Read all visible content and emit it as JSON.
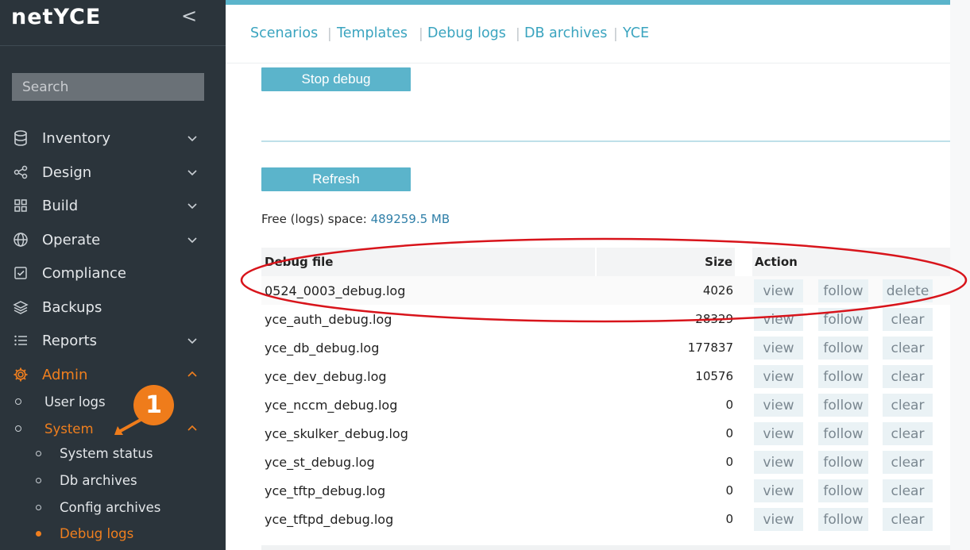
{
  "app": {
    "logo": "netYCE",
    "collapse_icon": "chevron-left-icon"
  },
  "search": {
    "placeholder": "Search"
  },
  "nav": {
    "items": [
      {
        "label": "Inventory",
        "icon": "database-icon",
        "has_chevron": true
      },
      {
        "label": "Design",
        "icon": "share-icon",
        "has_chevron": true
      },
      {
        "label": "Build",
        "icon": "grid-icon",
        "has_chevron": true
      },
      {
        "label": "Operate",
        "icon": "globe-icon",
        "has_chevron": true
      },
      {
        "label": "Compliance",
        "icon": "checkbox-icon",
        "has_chevron": false
      },
      {
        "label": "Backups",
        "icon": "layers-icon",
        "has_chevron": false
      },
      {
        "label": "Reports",
        "icon": "list-icon",
        "has_chevron": true
      },
      {
        "label": "Admin",
        "icon": "gear-icon",
        "has_chevron": true,
        "active": true
      }
    ],
    "admin_sub": [
      {
        "label": "User logs"
      },
      {
        "label": "System",
        "active": true
      }
    ],
    "system_sub": [
      {
        "label": "System status"
      },
      {
        "label": "Db archives"
      },
      {
        "label": "Config archives"
      },
      {
        "label": "Debug logs",
        "active": true
      }
    ]
  },
  "tabs": [
    "Scenarios",
    "Templates",
    "Debug logs",
    "DB archives",
    "YCE"
  ],
  "buttons": {
    "stop_debug": "Stop debug",
    "refresh": "Refresh"
  },
  "free_space": {
    "label": "Free (logs) space:",
    "value": "489259.5 MB"
  },
  "table": {
    "headers": {
      "file": "Debug file",
      "size": "Size",
      "action": "Action"
    },
    "rows": [
      {
        "file": "0524_0003_debug.log",
        "size": "4026",
        "actions": [
          "view",
          "follow",
          "delete"
        ]
      },
      {
        "file": "yce_auth_debug.log",
        "size": "28329",
        "actions": [
          "view",
          "follow",
          "clear"
        ]
      },
      {
        "file": "yce_db_debug.log",
        "size": "177837",
        "actions": [
          "view",
          "follow",
          "clear"
        ]
      },
      {
        "file": "yce_dev_debug.log",
        "size": "10576",
        "actions": [
          "view",
          "follow",
          "clear"
        ]
      },
      {
        "file": "yce_nccm_debug.log",
        "size": "0",
        "actions": [
          "view",
          "follow",
          "clear"
        ]
      },
      {
        "file": "yce_skulker_debug.log",
        "size": "0",
        "actions": [
          "view",
          "follow",
          "clear"
        ]
      },
      {
        "file": "yce_st_debug.log",
        "size": "0",
        "actions": [
          "view",
          "follow",
          "clear"
        ]
      },
      {
        "file": "yce_tftp_debug.log",
        "size": "0",
        "actions": [
          "view",
          "follow",
          "clear"
        ]
      },
      {
        "file": "yce_tftpd_debug.log",
        "size": "0",
        "actions": [
          "view",
          "follow",
          "clear"
        ]
      }
    ]
  },
  "annotation": {
    "badge": "1"
  },
  "colors": {
    "sidebar": "#2b343b",
    "accent": "#5bb4cb",
    "orange": "#f07f1e",
    "link": "#3aa4bf",
    "annotation_red": "#d8141b"
  }
}
